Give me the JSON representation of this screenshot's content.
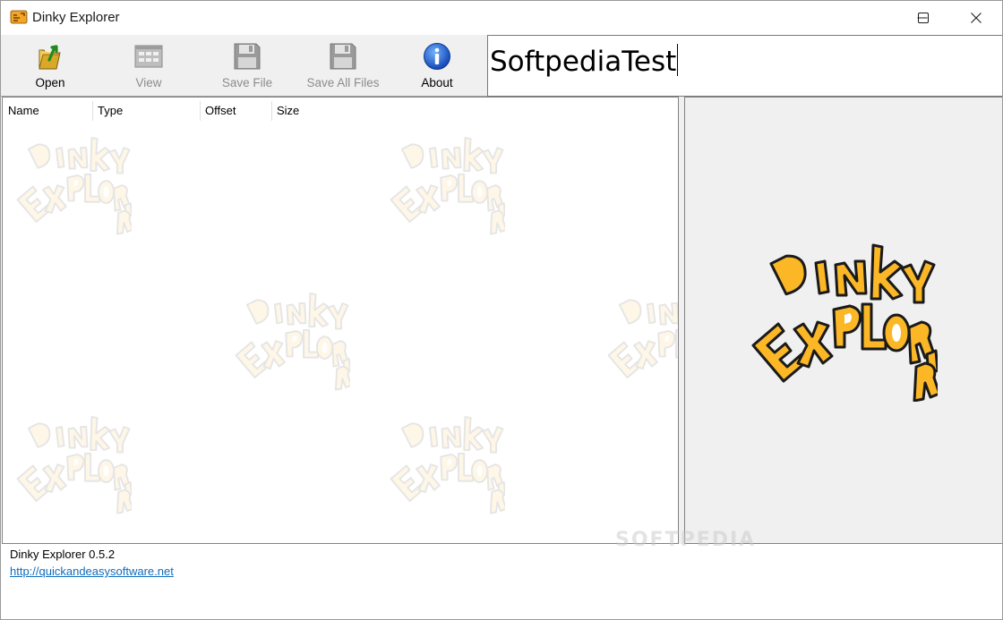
{
  "window": {
    "title": "Dinky Explorer",
    "icon": "dinky-app-icon"
  },
  "toolbar": {
    "open_label": "Open",
    "view_label": "View",
    "save_file_label": "Save File",
    "save_all_label": "Save All Files",
    "about_label": "About"
  },
  "search": {
    "value": "SoftpediaTest"
  },
  "list": {
    "columns": [
      "Name",
      "Type",
      "Offset",
      "Size"
    ],
    "rows": []
  },
  "footer": {
    "version": "Dinky Explorer 0.5.2",
    "link": "http://quickandeasysoftware.net"
  },
  "watermark_text": "SOFTPEDIA",
  "colors": {
    "logo_fill": "#fbb726",
    "logo_stroke": "#1a1a1a",
    "link": "#0f6cbd",
    "toolbar_bg": "#f0f0f0",
    "about_icon": "#1e63c8"
  }
}
